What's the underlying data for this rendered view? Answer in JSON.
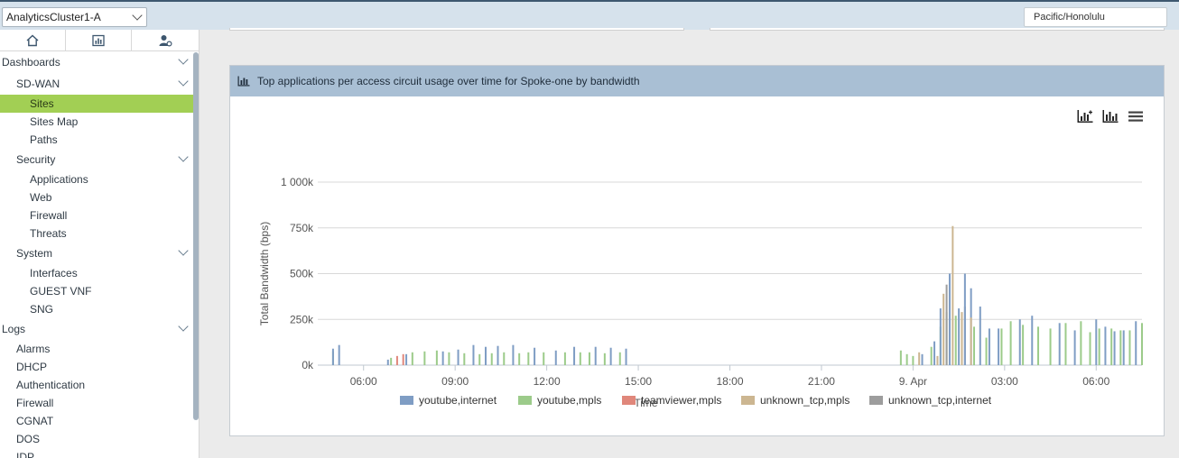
{
  "topbar": {
    "cluster": "AnalyticsCluster1-A",
    "timezone": "Pacific/Honolulu"
  },
  "sidebar": {
    "tabs": [
      "home-icon",
      "bar-chart-icon",
      "user-settings-icon"
    ],
    "items": [
      {
        "label": "Dashboards",
        "level": 0,
        "expandable": true
      },
      {
        "label": "SD-WAN",
        "level": 1,
        "expandable": true
      },
      {
        "label": "Sites",
        "level": 2,
        "active": true
      },
      {
        "label": "Sites Map",
        "level": 2
      },
      {
        "label": "Paths",
        "level": 2
      },
      {
        "label": "Security",
        "level": 1,
        "expandable": true
      },
      {
        "label": "Applications",
        "level": 2
      },
      {
        "label": "Web",
        "level": 2
      },
      {
        "label": "Firewall",
        "level": 2
      },
      {
        "label": "Threats",
        "level": 2
      },
      {
        "label": "System",
        "level": 1,
        "expandable": true
      },
      {
        "label": "Interfaces",
        "level": 2
      },
      {
        "label": "GUEST VNF",
        "level": 2
      },
      {
        "label": "SNG",
        "level": 2
      },
      {
        "label": "Logs",
        "level": 0,
        "expandable": true
      },
      {
        "label": "Alarms",
        "level": 1
      },
      {
        "label": "DHCP",
        "level": 1
      },
      {
        "label": "Authentication",
        "level": 1
      },
      {
        "label": "Firewall",
        "level": 1
      },
      {
        "label": "CGNAT",
        "level": 1
      },
      {
        "label": "DOS",
        "level": 1
      },
      {
        "label": "IDP",
        "level": 1
      }
    ]
  },
  "panel": {
    "title": "Top applications per access circuit usage over time for Spoke-one by bandwidth",
    "tools": [
      "chart-type-icon",
      "stacked-bar-icon",
      "menu-icon"
    ]
  },
  "chart_data": {
    "type": "bar",
    "title": "",
    "xlabel": "Time",
    "ylabel": "Total Bandwidth (bps)",
    "ylim": [
      0,
      1000000
    ],
    "y_ticks": [
      "0k",
      "250k",
      "500k",
      "750k",
      "1 000k"
    ],
    "x_ticks": [
      "06:00",
      "09:00",
      "12:00",
      "15:00",
      "18:00",
      "21:00",
      "9. Apr",
      "03:00",
      "06:00"
    ],
    "x_range_hours": [
      4.5,
      31.5
    ],
    "x_tick_hours": [
      6,
      9,
      12,
      15,
      18,
      21,
      24,
      27,
      30
    ],
    "grid": true,
    "legend_position": "bottom",
    "series": [
      {
        "name": "youtube,internet",
        "color": "#7f9dc4",
        "points": [
          [
            5.0,
            90000
          ],
          [
            5.2,
            110000
          ],
          [
            6.8,
            30000
          ],
          [
            7.4,
            60000
          ],
          [
            8.6,
            75000
          ],
          [
            9.1,
            85000
          ],
          [
            9.6,
            110000
          ],
          [
            10.0,
            100000
          ],
          [
            10.4,
            105000
          ],
          [
            10.9,
            110000
          ],
          [
            11.6,
            95000
          ],
          [
            12.3,
            80000
          ],
          [
            12.9,
            100000
          ],
          [
            13.6,
            100000
          ],
          [
            14.1,
            95000
          ],
          [
            14.6,
            90000
          ],
          [
            24.3,
            60000
          ],
          [
            24.7,
            130000
          ],
          [
            24.9,
            310000
          ],
          [
            25.2,
            500000
          ],
          [
            25.5,
            310000
          ],
          [
            25.7,
            500000
          ],
          [
            25.9,
            420000
          ],
          [
            26.2,
            320000
          ],
          [
            26.5,
            200000
          ],
          [
            26.8,
            200000
          ],
          [
            27.5,
            250000
          ],
          [
            27.9,
            270000
          ],
          [
            28.8,
            230000
          ],
          [
            29.3,
            190000
          ],
          [
            30.0,
            250000
          ],
          [
            30.3,
            210000
          ],
          [
            30.6,
            185000
          ],
          [
            30.9,
            190000
          ],
          [
            31.3,
            240000
          ]
        ]
      },
      {
        "name": "youtube,mpls",
        "color": "#9ccb8a",
        "points": [
          [
            5.0,
            75000
          ],
          [
            6.9,
            40000
          ],
          [
            7.6,
            70000
          ],
          [
            8.0,
            75000
          ],
          [
            8.4,
            80000
          ],
          [
            8.8,
            70000
          ],
          [
            9.3,
            65000
          ],
          [
            9.8,
            60000
          ],
          [
            10.2,
            65000
          ],
          [
            10.6,
            70000
          ],
          [
            11.1,
            65000
          ],
          [
            11.4,
            70000
          ],
          [
            11.9,
            70000
          ],
          [
            12.6,
            70000
          ],
          [
            13.1,
            70000
          ],
          [
            13.4,
            70000
          ],
          [
            13.9,
            65000
          ],
          [
            14.4,
            70000
          ],
          [
            23.6,
            80000
          ],
          [
            23.8,
            60000
          ],
          [
            24.0,
            50000
          ],
          [
            24.6,
            100000
          ],
          [
            24.9,
            210000
          ],
          [
            25.1,
            290000
          ],
          [
            25.4,
            270000
          ],
          [
            25.6,
            160000
          ],
          [
            26.0,
            210000
          ],
          [
            26.4,
            150000
          ],
          [
            26.9,
            200000
          ],
          [
            27.2,
            240000
          ],
          [
            27.6,
            220000
          ],
          [
            28.1,
            210000
          ],
          [
            28.5,
            200000
          ],
          [
            29.0,
            230000
          ],
          [
            29.5,
            240000
          ],
          [
            29.8,
            180000
          ],
          [
            30.1,
            200000
          ],
          [
            30.5,
            200000
          ],
          [
            30.8,
            190000
          ],
          [
            31.1,
            190000
          ],
          [
            31.5,
            230000
          ]
        ]
      },
      {
        "name": "teamviewer,mpls",
        "color": "#e0877b",
        "points": [
          [
            7.1,
            50000
          ],
          [
            7.3,
            60000
          ]
        ]
      },
      {
        "name": "unknown_tcp,mpls",
        "color": "#ccb691",
        "points": [
          [
            24.2,
            70000
          ],
          [
            24.8,
            50000
          ],
          [
            25.0,
            390000
          ],
          [
            25.3,
            760000
          ],
          [
            25.6,
            290000
          ],
          [
            25.9,
            260000
          ]
        ]
      },
      {
        "name": "unknown_tcp,internet",
        "color": "#9d9d9d",
        "points": [
          [
            25.1,
            440000
          ],
          [
            25.7,
            320000
          ]
        ]
      }
    ]
  }
}
